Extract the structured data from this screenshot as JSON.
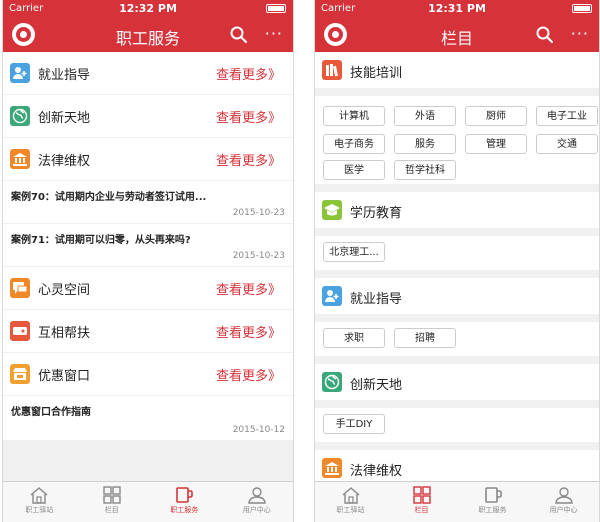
{
  "left": {
    "status": {
      "carrier": "Carrier",
      "time": "12:32 PM"
    },
    "title": "职工服务",
    "more_glyph": "···",
    "sections": [
      {
        "label": "就业指导",
        "more": "查看更多》",
        "icon": "person-add-icon",
        "color": "#4aa3e0"
      },
      {
        "label": "创新天地",
        "more": "查看更多》",
        "icon": "globe-icon",
        "color": "#3aa87a"
      },
      {
        "label": "法律维权",
        "more": "查看更多》",
        "icon": "court-icon",
        "color": "#f0882a"
      },
      {
        "label": "心灵空间",
        "more": "查看更多》",
        "icon": "chat-icon",
        "color": "#f0882a"
      },
      {
        "label": "互相帮扶",
        "more": "查看更多》",
        "icon": "ticket-icon",
        "color": "#e8583a"
      },
      {
        "label": "优惠窗口",
        "more": "查看更多》",
        "icon": "shop-icon",
        "color": "#f0a030"
      }
    ],
    "articles": [
      {
        "title": "案例70：试用期内企业与劳动者签订试用...",
        "date": "2015-10-23"
      },
      {
        "title": "案例71：试用期可以归零，从头再来吗?",
        "date": "2015-10-23"
      },
      {
        "title": "优惠窗口合作指南",
        "date": "2015-10-12"
      }
    ],
    "tabs": [
      "职工驿站",
      "栏目",
      "职工服务",
      "用户中心"
    ],
    "active_tab": 2
  },
  "right": {
    "status": {
      "carrier": "Carrier",
      "time": "12:31 PM"
    },
    "title": "栏目",
    "more_glyph": "···",
    "categories": [
      {
        "label": "技能培训",
        "icon": "books-icon",
        "color": "#e8583a",
        "chips": [
          "计算机",
          "外语",
          "厨师",
          "电子工业",
          "电子商务",
          "服务",
          "管理",
          "交通",
          "医学",
          "哲学社科"
        ]
      },
      {
        "label": "学历教育",
        "icon": "graduation-cap-icon",
        "color": "#8ac43a",
        "chips": [
          "北京理工..."
        ]
      },
      {
        "label": "就业指导",
        "icon": "person-add-icon",
        "color": "#4aa3e0",
        "chips": [
          "求职",
          "招聘"
        ]
      },
      {
        "label": "创新天地",
        "icon": "globe-icon",
        "color": "#3aa87a",
        "chips": [
          "手工DIY"
        ]
      },
      {
        "label": "法律维权",
        "icon": "court-icon",
        "color": "#f0882a",
        "chips": []
      }
    ],
    "tabs": [
      "职工驿站",
      "栏目",
      "职工服务",
      "用户中心"
    ],
    "active_tab": 1
  }
}
